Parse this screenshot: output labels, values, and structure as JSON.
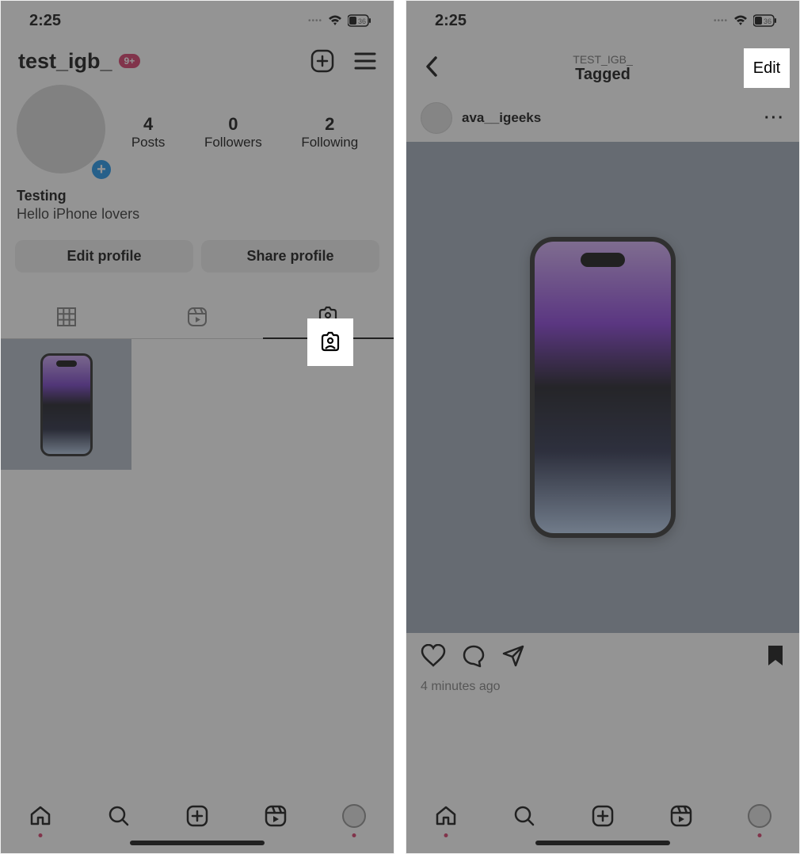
{
  "status": {
    "time": "2:25",
    "battery": "36"
  },
  "left": {
    "username": "test_igb_",
    "badge": "9+",
    "stats": {
      "posts": {
        "num": "4",
        "label": "Posts"
      },
      "followers": {
        "num": "0",
        "label": "Followers"
      },
      "following": {
        "num": "2",
        "label": "Following"
      }
    },
    "bio_name": "Testing",
    "bio_text": "Hello iPhone lovers",
    "edit_profile": "Edit profile",
    "share_profile": "Share profile"
  },
  "right": {
    "subtitle": "TEST_IGB_",
    "title": "Tagged",
    "edit": "Edit",
    "post_user": "ava__igeeks",
    "timestamp": "4 minutes ago"
  }
}
